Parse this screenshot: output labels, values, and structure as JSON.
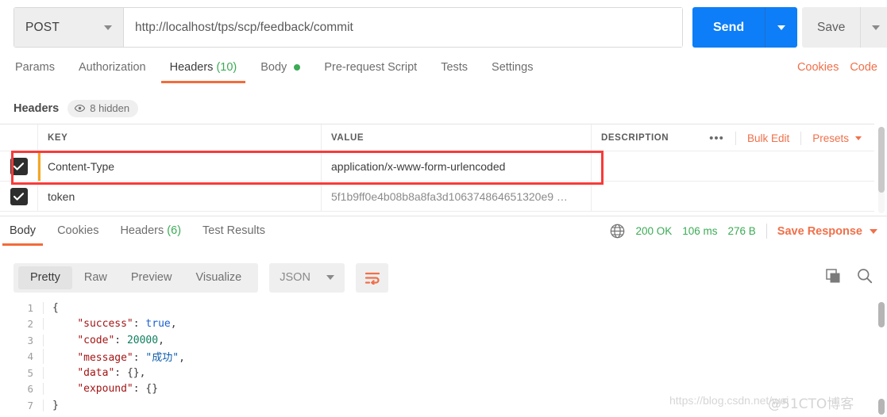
{
  "request": {
    "method": "POST",
    "url": "http://localhost/tps/scp/feedback/commit",
    "send_label": "Send",
    "save_label": "Save"
  },
  "request_tabs": [
    {
      "label": "Params",
      "count": "",
      "active": false,
      "dot": false
    },
    {
      "label": "Authorization",
      "count": "",
      "active": false,
      "dot": false
    },
    {
      "label": "Headers",
      "count": "(10)",
      "active": true,
      "dot": false
    },
    {
      "label": "Body",
      "count": "",
      "active": false,
      "dot": true
    },
    {
      "label": "Pre-request Script",
      "count": "",
      "active": false,
      "dot": false
    },
    {
      "label": "Tests",
      "count": "",
      "active": false,
      "dot": false
    },
    {
      "label": "Settings",
      "count": "",
      "active": false,
      "dot": false
    }
  ],
  "tabs_right": {
    "cookies": "Cookies",
    "code": "Code"
  },
  "headers_section": {
    "title": "Headers",
    "hidden_badge": "8 hidden",
    "eye_icon": "eye-icon",
    "columns": [
      "KEY",
      "VALUE",
      "DESCRIPTION"
    ],
    "actions": {
      "more": "•••",
      "bulk_edit": "Bulk Edit",
      "presets": "Presets"
    },
    "rows": [
      {
        "checked": true,
        "key": "Content-Type",
        "value": "application/x-www-form-urlencoded",
        "description": "",
        "focused": true,
        "highlighted": true
      },
      {
        "checked": true,
        "key": "token",
        "value": "5f1b9ff0e4b08b8a8fa3d106374864651320e9 …",
        "description": "",
        "focused": false,
        "highlighted": false
      }
    ]
  },
  "response_tabs": [
    {
      "label": "Body",
      "count": "",
      "active": true
    },
    {
      "label": "Cookies",
      "count": "",
      "active": false
    },
    {
      "label": "Headers",
      "count": "(6)",
      "active": false
    },
    {
      "label": "Test Results",
      "count": "",
      "active": false
    }
  ],
  "response_meta": {
    "globe_icon": "globe-icon",
    "status": "200 OK",
    "time": "106 ms",
    "size": "276 B",
    "save_response": "Save Response"
  },
  "body_toolbar": {
    "views": [
      {
        "label": "Pretty",
        "active": true
      },
      {
        "label": "Raw",
        "active": false
      },
      {
        "label": "Preview",
        "active": false
      },
      {
        "label": "Visualize",
        "active": false
      }
    ],
    "format": "JSON",
    "wrap_icon": "wrap-text-icon",
    "copy_icon": "copy-icon",
    "search_icon": "search-icon"
  },
  "response_body": {
    "line_numbers": [
      "1",
      "2",
      "3",
      "4",
      "5",
      "6",
      "7"
    ],
    "lines": [
      [
        {
          "t": "{",
          "c": "p"
        }
      ],
      [
        {
          "t": "    ",
          "c": "p"
        },
        {
          "t": "\"success\"",
          "c": "k"
        },
        {
          "t": ": ",
          "c": "p"
        },
        {
          "t": "true",
          "c": "b"
        },
        {
          "t": ",",
          "c": "p"
        }
      ],
      [
        {
          "t": "    ",
          "c": "p"
        },
        {
          "t": "\"code\"",
          "c": "k"
        },
        {
          "t": ": ",
          "c": "p"
        },
        {
          "t": "20000",
          "c": "n"
        },
        {
          "t": ",",
          "c": "p"
        }
      ],
      [
        {
          "t": "    ",
          "c": "p"
        },
        {
          "t": "\"message\"",
          "c": "k"
        },
        {
          "t": ": ",
          "c": "p"
        },
        {
          "t": "\"成功\"",
          "c": "s"
        },
        {
          "t": ",",
          "c": "p"
        }
      ],
      [
        {
          "t": "    ",
          "c": "p"
        },
        {
          "t": "\"data\"",
          "c": "k"
        },
        {
          "t": ": ",
          "c": "p"
        },
        {
          "t": "{}",
          "c": "p"
        },
        {
          "t": ",",
          "c": "p"
        }
      ],
      [
        {
          "t": "    ",
          "c": "p"
        },
        {
          "t": "\"expound\"",
          "c": "k"
        },
        {
          "t": ": ",
          "c": "p"
        },
        {
          "t": "{}",
          "c": "p"
        }
      ],
      [
        {
          "t": "}",
          "c": "p"
        }
      ]
    ],
    "json": {
      "success": true,
      "code": 20000,
      "message": "成功",
      "data": {},
      "expound": {}
    }
  },
  "watermarks": {
    "csdn": "https://blog.csdn.net/wei",
    "cto": "@51CTO博客"
  },
  "colors": {
    "accent_orange": "#f26b3a",
    "link_orange": "#f0704a",
    "send_blue": "#0d7ef7",
    "success_green": "#3bab55",
    "highlight_red": "#f93a3a",
    "focus_amber": "#f5a623"
  }
}
